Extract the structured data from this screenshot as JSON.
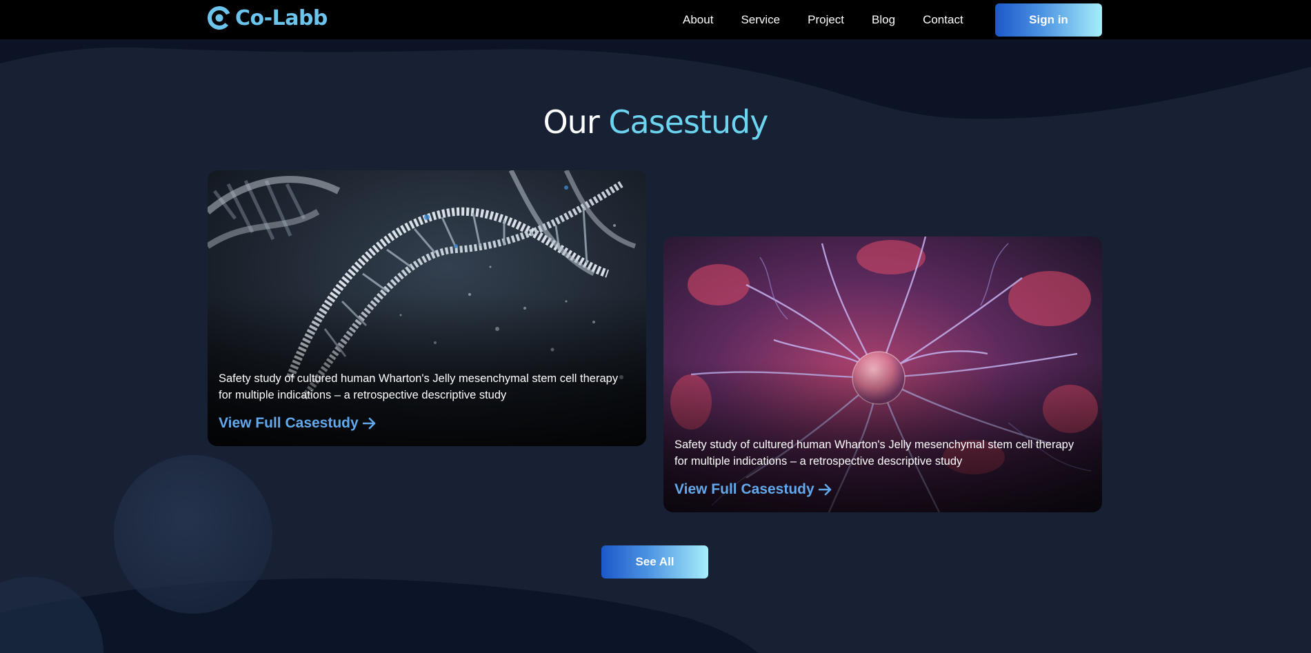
{
  "nav": {
    "brand": "Co-Labb",
    "links": [
      "About",
      "Service",
      "Project",
      "Blog",
      "Contact"
    ],
    "signin_label": "Sign in"
  },
  "section": {
    "title_plain": "Our",
    "title_accent": "Casestudy"
  },
  "cards": [
    {
      "image": "dna-helix",
      "description": "Safety study of cultured human Wharton's Jelly mesenchymal stem cell therapy for multiple indications – a retrospective descriptive study",
      "link_label": "View Full Casestudy"
    },
    {
      "image": "neuron-plasma",
      "description": "Safety study of cultured human Wharton's Jelly mesenchymal stem cell therapy for multiple indications – a retrospective descriptive study",
      "link_label": "View Full Casestudy"
    }
  ],
  "see_all_label": "See All",
  "colors": {
    "background": "#182034",
    "nav_background": "#000000",
    "accent": "#6cd4ef",
    "brand": "#6cc3ec",
    "link": "#62a9ee",
    "button_gradient_start": "#1b58c9",
    "button_gradient_end": "#a6eefa"
  }
}
